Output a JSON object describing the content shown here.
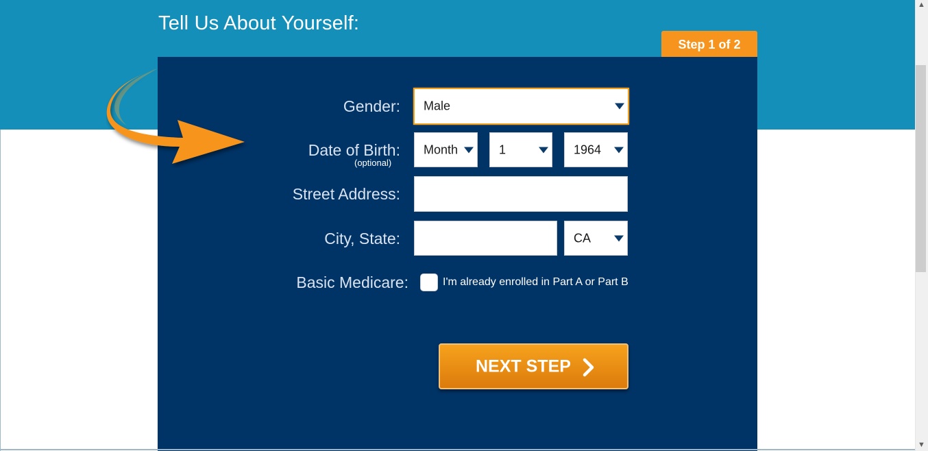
{
  "header": {
    "title": "Tell Us About Yourself:",
    "step_badge": "Step 1 of 2"
  },
  "form": {
    "gender": {
      "label": "Gender:",
      "value": "Male"
    },
    "dob": {
      "label": "Date of Birth:",
      "sublabel": "(optional)",
      "month": "Month",
      "day": "1",
      "year": "1964"
    },
    "street": {
      "label": "Street Address:",
      "value": ""
    },
    "city_state": {
      "label": "City, State:",
      "city_value": "",
      "state": "CA"
    },
    "medicare": {
      "label": "Basic Medicare:",
      "checkbox_label": "I'm already enrolled in Part A or Part B",
      "checked": false
    },
    "next_button": "NEXT STEP"
  },
  "icons": {
    "arrow": "curved-arrow-icon",
    "caret": "chevron-down-icon",
    "next": "chevron-right-icon"
  },
  "colors": {
    "hero": "#138fb9",
    "panel": "#003366",
    "accent": "#f7941d"
  }
}
